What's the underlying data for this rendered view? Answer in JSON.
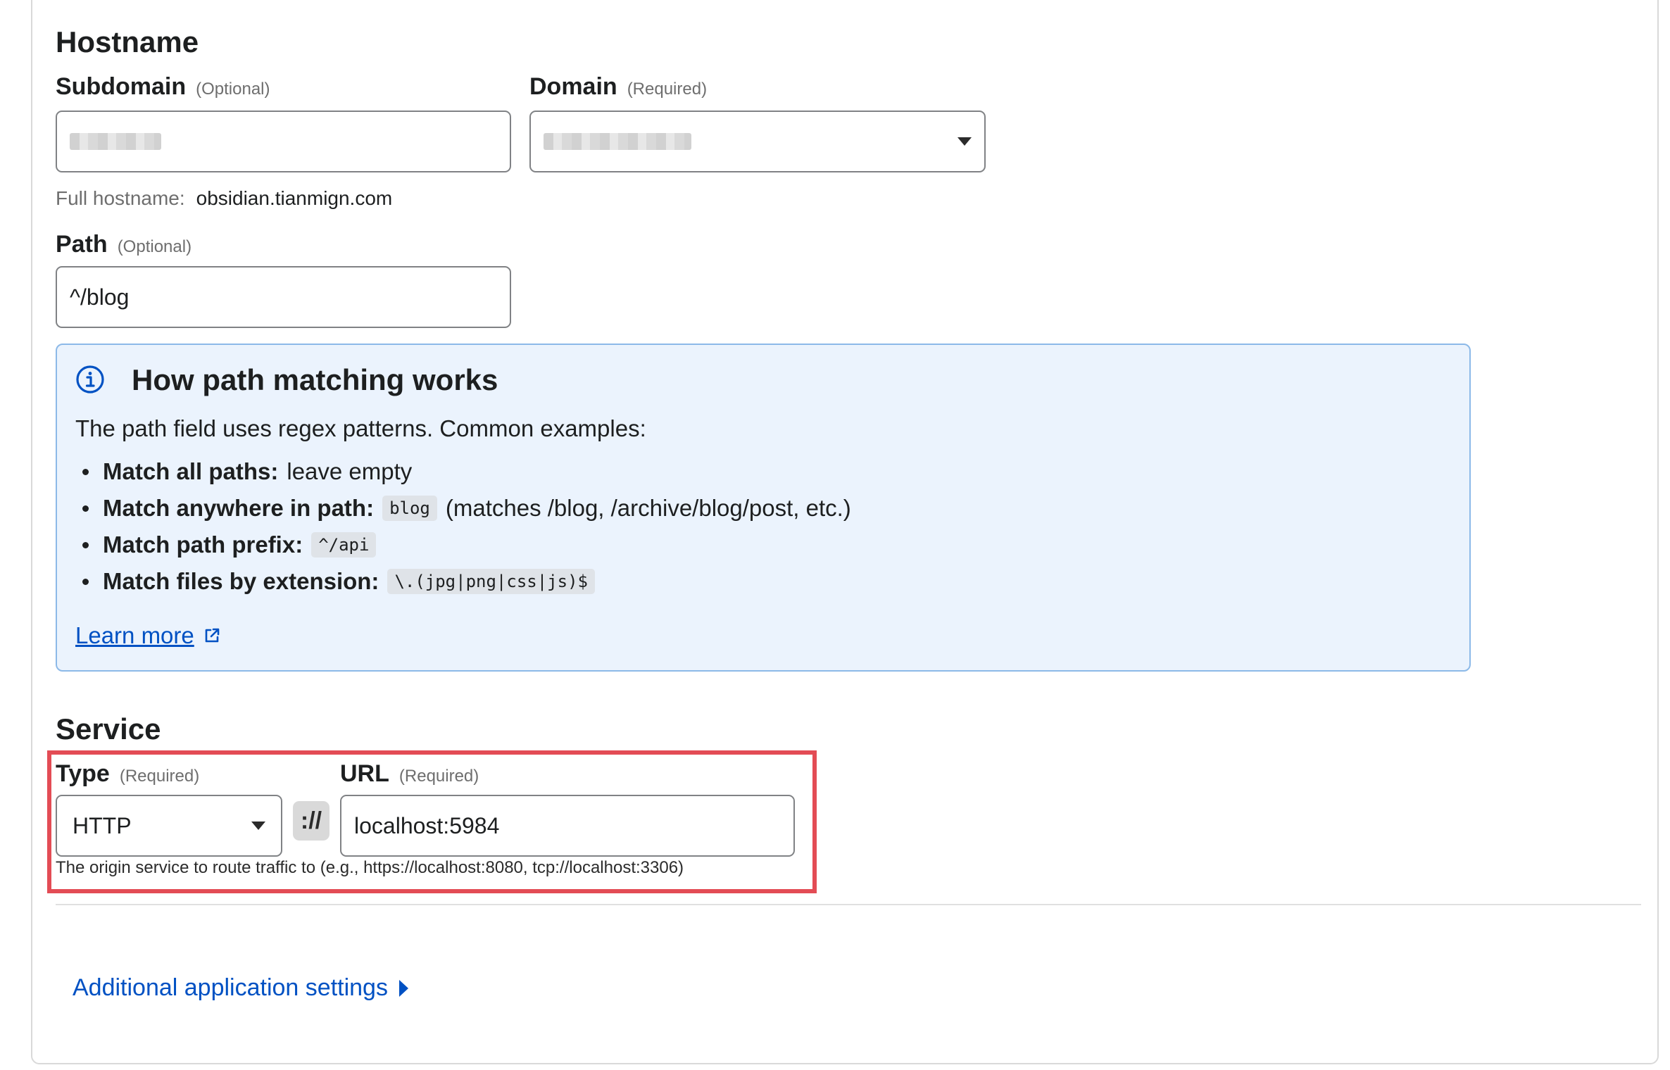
{
  "hostname": {
    "title": "Hostname",
    "subdomain": {
      "label": "Subdomain",
      "note": "(Optional)",
      "value": ""
    },
    "domain": {
      "label": "Domain",
      "note": "(Required)",
      "value": ""
    },
    "full_hostname_label": "Full hostname:",
    "full_hostname_value": "obsidian.tianmign.com",
    "path": {
      "label": "Path",
      "note": "(Optional)",
      "value": "^/blog"
    }
  },
  "info": {
    "icon": "info-icon",
    "title": "How path matching works",
    "intro": "The path field uses regex patterns. Common examples:",
    "items": [
      {
        "bold": "Match all paths:",
        "code": "",
        "text": "leave empty"
      },
      {
        "bold": "Match anywhere in path:",
        "code": "blog",
        "text": "(matches /blog, /archive/blog/post, etc.)"
      },
      {
        "bold": "Match path prefix:",
        "code": "^/api",
        "text": ""
      },
      {
        "bold": "Match files by extension:",
        "code": "\\.(jpg|png|css|js)$",
        "text": ""
      }
    ],
    "link_label": "Learn more",
    "link_icon": "external-link-icon"
  },
  "service": {
    "title": "Service",
    "type": {
      "label": "Type",
      "note": "(Required)",
      "value": "HTTP"
    },
    "scheme_separator": "://",
    "url": {
      "label": "URL",
      "note": "(Required)",
      "value": "localhost:5984"
    },
    "help": "The origin service to route traffic to (e.g., https://localhost:8080, tcp://localhost:3306)"
  },
  "additional_settings_label": "Additional application settings",
  "colors": {
    "accent": "#0051c3",
    "highlight": "#e34c55",
    "info_bg": "#ebf3fd",
    "info_border": "#8cb9e8"
  }
}
